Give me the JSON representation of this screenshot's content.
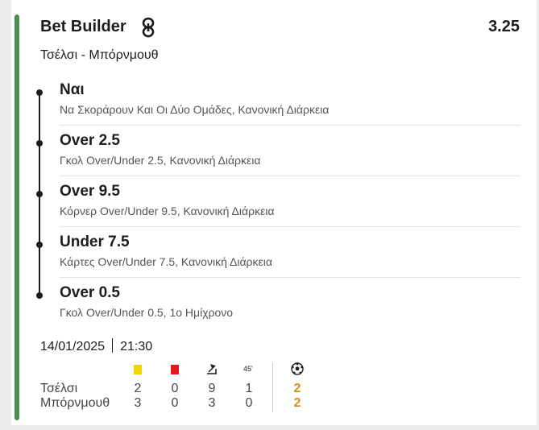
{
  "bet": {
    "title": "Bet Builder",
    "odds": "3.25",
    "match": "Τσέλσι - Μπόρνμουθ"
  },
  "selections": [
    {
      "value": "Ναι",
      "market": "Να Σκοράρουν Και Οι Δύο Ομάδες, Κανονική Διάρκεια"
    },
    {
      "value": "Over 2.5",
      "market": "Γκολ Over/Under 2.5, Κανονική Διάρκεια"
    },
    {
      "value": "Over 9.5",
      "market": "Κόρνερ Over/Under 9.5, Κανονική Διάρκεια"
    },
    {
      "value": "Under 7.5",
      "market": "Κάρτες Over/Under 7.5, Κανονική Διάρκεια"
    },
    {
      "value": "Over 0.5",
      "market": "Γκολ Over/Under 0.5, 1ο Ημίχρονο"
    }
  ],
  "event": {
    "date": "14/01/2025",
    "time": "21:30"
  },
  "stats": {
    "icons": [
      "yellow-card-icon",
      "red-card-icon",
      "corner-flag-icon",
      "45-minute-icon",
      "football-icon"
    ],
    "label_45": "45'",
    "home": {
      "name": "Τσέλσι",
      "yellow": "2",
      "red": "0",
      "corners": "9",
      "half": "1",
      "goals": "2"
    },
    "away": {
      "name": "Μπόρνμουθ",
      "yellow": "3",
      "red": "0",
      "corners": "3",
      "half": "0",
      "goals": "2"
    }
  },
  "colors": {
    "accent": "#4a8f4b",
    "goals": "#e08a14",
    "yellow_card": "#f2d20a",
    "red_card": "#e0191b"
  }
}
